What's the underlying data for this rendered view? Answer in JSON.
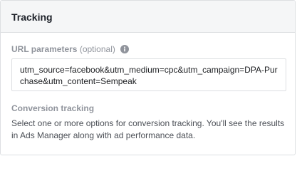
{
  "panel": {
    "title": "Tracking"
  },
  "url_parameters": {
    "label": "URL parameters",
    "optional_text": "(optional)",
    "info_icon": "info-circle-icon",
    "value": "utm_source=facebook&utm_medium=cpc&utm_campaign=DPA-Purchase&utm_content=Sempeak"
  },
  "conversion_tracking": {
    "label": "Conversion tracking",
    "description": "Select one or more options for conversion tracking. You'll see the results in Ads Manager along with ad performance data."
  },
  "colors": {
    "header_bg": "#f5f6f7",
    "border": "#dddfe2",
    "muted_label": "#90949c",
    "text": "#1c1e21"
  }
}
